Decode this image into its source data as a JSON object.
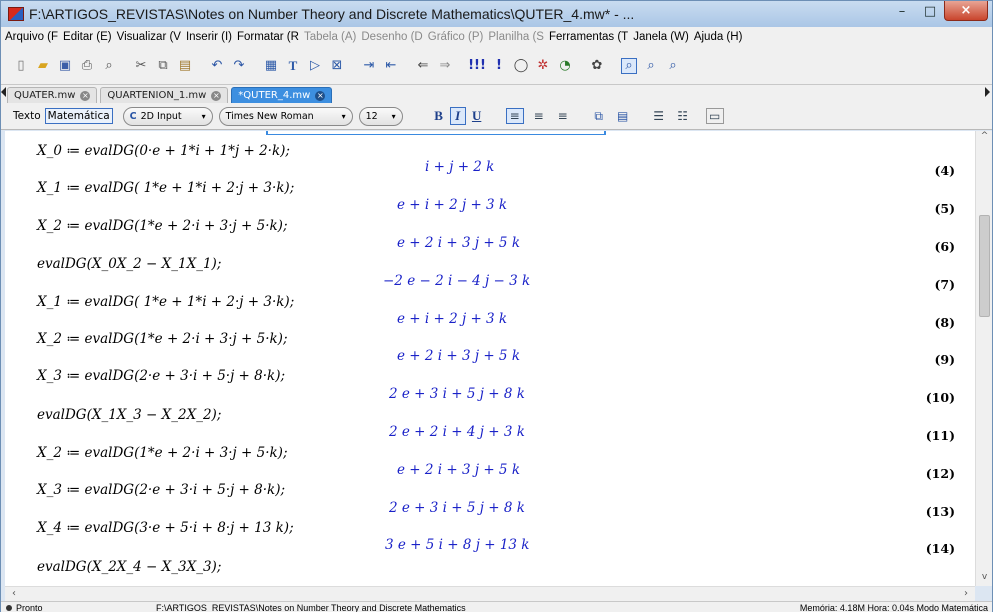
{
  "window": {
    "title": "F:\\ARTIGOS_REVISTAS\\Notes on Number Theory and Discrete Mathematics\\QUTER_4.mw* - ...",
    "minimize": "–",
    "maximize": "□",
    "close": "×"
  },
  "menu": [
    "Arquivo (F",
    "Editar (E)",
    "Visualizar (V",
    "Inserir (I)",
    "Formatar (R",
    "Tabela (A)",
    "Desenho (D",
    "Gráfico (P)",
    "Planilha (S",
    "Ferramentas (T",
    "Janela (W)",
    "Ajuda (H)"
  ],
  "tabs": [
    {
      "label": "QUATER.mw",
      "active": false
    },
    {
      "label": "QUARTENION_1.mw",
      "active": false
    },
    {
      "label": "*QUTER_4.mw",
      "active": true
    }
  ],
  "format": {
    "mode_text": "Texto",
    "mode_math": "Matemática",
    "input_style": "2D Input",
    "font_family": "Times New Roman",
    "font_size": "12",
    "bold": "B",
    "italic": "I",
    "underline": "U"
  },
  "worksheet": {
    "rows": [
      {
        "input": "X_0 ≔ evalDG(0·e + 1*i + 1*j + 2·k);",
        "output": "i + j + 2 k",
        "label": "(4)"
      },
      {
        "input": "X_1 ≔ evalDG( 1*e + 1*i + 2·j + 3·k);",
        "output": "e + i + 2 j + 3 k",
        "label": "(5)"
      },
      {
        "input": "X_2 ≔ evalDG(1*e + 2·i + 3·j + 5·k);",
        "output": "e + 2 i + 3 j + 5 k",
        "label": "(6)"
      },
      {
        "input": "evalDG(X_0X_2 − X_1X_1);",
        "output": "−2 e − 2 i − 4 j − 3 k",
        "label": "(7)"
      },
      {
        "input": "X_1 ≔ evalDG( 1*e + 1*i + 2·j + 3·k);",
        "output": "e + i + 2 j + 3 k",
        "label": "(8)"
      },
      {
        "input": "X_2 ≔ evalDG(1*e + 2·i + 3·j + 5·k);",
        "output": "e + 2 i + 3 j + 5 k",
        "label": "(9)"
      },
      {
        "input": "X_3 ≔ evalDG(2·e + 3·i + 5·j + 8·k);",
        "output": "2 e + 3 i + 5 j + 8 k",
        "label": "(10)"
      },
      {
        "input": "evalDG(X_1X_3 − X_2X_2);",
        "output": "2 e + 2 i + 4 j + 3 k",
        "label": "(11)"
      },
      {
        "input": "X_2 ≔ evalDG(1*e + 2·i + 3·j + 5·k);",
        "output": "e + 2 i + 3 j + 5 k",
        "label": "(12)"
      },
      {
        "input": "X_3 ≔ evalDG(2·e + 3·i + 5·j + 8·k);",
        "output": "2 e + 3 i + 5 j + 8 k",
        "label": "(13)"
      },
      {
        "input": "X_4 ≔ evalDG(3·e + 5·i + 8·j + 13 k);",
        "output": "3 e + 5 i + 8 j + 13 k",
        "label": "(14)"
      },
      {
        "input": "evalDG(X_2X_4 − X_3X_3);",
        "output": "",
        "label": ""
      }
    ]
  },
  "status": {
    "ready": "Pronto",
    "path": "F:\\ARTIGOS_REVISTAS\\Notes on Number Theory and Discrete Mathematics",
    "info": "Memória: 4.18M  Hora: 0.04s  Modo Matemática"
  }
}
